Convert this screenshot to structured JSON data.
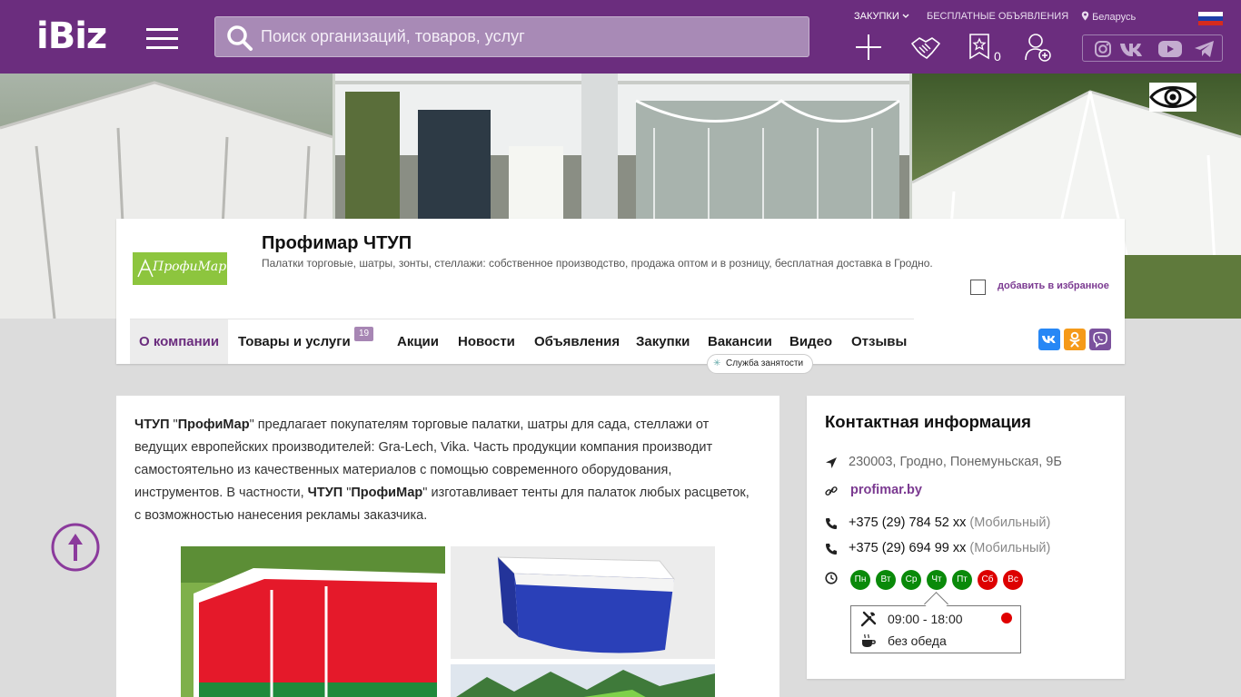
{
  "header": {
    "logo": "iBiz",
    "search_placeholder": "Поиск организаций, товаров, услуг",
    "purchases": "ЗАКУПКИ",
    "free_ads": "БЕСПЛАТНЫЕ ОБЪЯВЛЕНИЯ",
    "region": "Беларусь",
    "favorites_count": "0",
    "icons": [
      "plus-icon",
      "handshake-icon",
      "favorites-star-icon",
      "add-user-icon"
    ],
    "social": [
      "instagram-icon",
      "vk-icon",
      "youtube-icon",
      "telegram-icon"
    ]
  },
  "company": {
    "logo_text": "ПрофиМар",
    "name": "Профимар ЧТУП",
    "description": "Палатки торговые, шатры, зонты, стеллажи: собственное производство, продажа оптом и в розницу, бесплатная доставка в Гродно.",
    "add_favorite": "добавить в избранное"
  },
  "tabs": [
    {
      "label": "О компании",
      "active": true
    },
    {
      "label": "Товары и услуги",
      "badge": "19"
    },
    {
      "label": "Акции"
    },
    {
      "label": "Новости"
    },
    {
      "label": "Объявления"
    },
    {
      "label": "Закупки"
    },
    {
      "label": "Вакансии"
    },
    {
      "label": "Видео"
    },
    {
      "label": "Отзывы"
    }
  ],
  "vacancy_tip": "Служба занятости",
  "share": [
    "vk-share-icon",
    "ok-share-icon",
    "viber-share-icon"
  ],
  "article": {
    "p1_a": "ЧТУП",
    "p1_b": "ПрофиМар",
    "p1_c": " предлагает покупателям торговые палатки, шатры для сада, стеллажи от ведущих европейских производителей: Gra-Lech, Vika. Часть продукции компания производит самостоятельно из качественных материалов с помощью современного оборудования, инструментов. В частности, ",
    "p1_d": "ЧТУП",
    "p1_e": "ПрофиМар",
    "p1_f": " изготавливает тенты для палаток любых расцветок, с возможностью нанесения рекламы заказчика."
  },
  "contact": {
    "title": "Контактная информация",
    "address": "230003, Гродно, Понемуньская, 9Б",
    "website": "profimar.by",
    "phones": [
      {
        "number": "+375 (29) 784 52 xx",
        "type": "(Мобильный)"
      },
      {
        "number": "+375 (29) 694 99 xx",
        "type": "(Мобильный)"
      }
    ],
    "days": [
      {
        "label": "Пн",
        "color": "#0a8a0a"
      },
      {
        "label": "Вт",
        "color": "#0a8a0a"
      },
      {
        "label": "Ср",
        "color": "#0a8a0a"
      },
      {
        "label": "Чт",
        "color": "#0a8a0a"
      },
      {
        "label": "Пт",
        "color": "#0a8a0a"
      },
      {
        "label": "Сб",
        "color": "#dd0000"
      },
      {
        "label": "Вс",
        "color": "#dd0000"
      }
    ],
    "hours": "09:00 - 18:00",
    "lunch": "без обеда"
  },
  "colors": {
    "brand": "#6b2d7e",
    "accent": "#7b3a91"
  }
}
